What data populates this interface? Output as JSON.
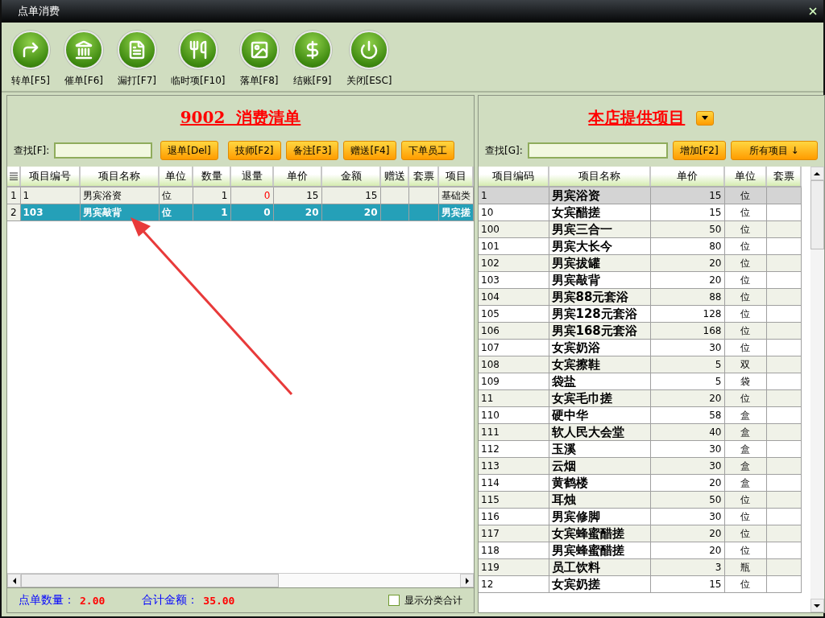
{
  "window": {
    "title": "点单消费"
  },
  "toolbar": [
    {
      "label": "转单[F5]"
    },
    {
      "label": "催单[F6]"
    },
    {
      "label": "漏打[F7]"
    },
    {
      "label": "临时项[F10]"
    },
    {
      "label": "落单[F8]"
    },
    {
      "label": "结账[F9]"
    },
    {
      "label": "关闭[ESC]"
    }
  ],
  "order_panel": {
    "title": "9002  消费清单",
    "search": {
      "label": "查找[F]:"
    },
    "buttons": [
      "退单[Del]",
      "技师[F2]",
      "备注[F3]",
      "赠送[F4]",
      "下单员工"
    ],
    "columns": [
      {
        "label": "项目编号"
      },
      {
        "label": "项目名称"
      },
      {
        "label": "单位"
      },
      {
        "label": "数量"
      },
      {
        "label": "退量",
        "kind": "return"
      },
      {
        "label": "单价"
      },
      {
        "label": "金额"
      },
      {
        "label": "赠送"
      },
      {
        "label": "套票"
      },
      {
        "label": "项目"
      }
    ],
    "rows": [
      {
        "number": "1",
        "selected": false,
        "cells": [
          "1",
          "男宾浴资",
          "位",
          "1",
          "0",
          "15",
          "15",
          "",
          "",
          "基础类"
        ]
      },
      {
        "number": "2",
        "selected": true,
        "cells": [
          "103",
          "男宾敲背",
          "位",
          "1",
          "0",
          "20",
          "20",
          "",
          "",
          "男宾搓"
        ]
      }
    ],
    "footer": {
      "count_label": "点单数量：",
      "count": "2.00",
      "total_label": "合计金额：",
      "total": "35.00",
      "category_toggle": {
        "label": "显示分类合计",
        "checked": false
      }
    }
  },
  "items_panel": {
    "title": "本店提供项目",
    "search": {
      "label": "查找[G]:"
    },
    "buttons": [
      "增加[F2]",
      "所有项目 ↓"
    ],
    "columns": [
      {
        "label": "项目编码"
      },
      {
        "label": "项目名称"
      },
      {
        "label": "单价"
      },
      {
        "label": "单位"
      },
      {
        "label": "套票"
      }
    ],
    "rows": [
      {
        "selected": true,
        "cells": [
          "1",
          "男宾浴资",
          "15",
          "位",
          ""
        ]
      },
      {
        "selected": false,
        "cells": [
          "10",
          "女宾醋搓",
          "15",
          "位",
          ""
        ]
      },
      {
        "selected": false,
        "cells": [
          "100",
          "男宾三合一",
          "50",
          "位",
          ""
        ]
      },
      {
        "selected": false,
        "cells": [
          "101",
          "男宾大长今",
          "80",
          "位",
          ""
        ]
      },
      {
        "selected": false,
        "cells": [
          "102",
          "男宾拔罐",
          "20",
          "位",
          ""
        ]
      },
      {
        "selected": false,
        "cells": [
          "103",
          "男宾敲背",
          "20",
          "位",
          ""
        ]
      },
      {
        "selected": false,
        "cells": [
          "104",
          "男宾88元套浴",
          "88",
          "位",
          ""
        ]
      },
      {
        "selected": false,
        "cells": [
          "105",
          "男宾128元套浴",
          "128",
          "位",
          ""
        ]
      },
      {
        "selected": false,
        "cells": [
          "106",
          "男宾168元套浴",
          "168",
          "位",
          ""
        ]
      },
      {
        "selected": false,
        "cells": [
          "107",
          "女宾奶浴",
          "30",
          "位",
          ""
        ]
      },
      {
        "selected": false,
        "cells": [
          "108",
          "女宾擦鞋",
          "5",
          "双",
          ""
        ]
      },
      {
        "selected": false,
        "cells": [
          "109",
          "袋盐",
          "5",
          "袋",
          ""
        ]
      },
      {
        "selected": false,
        "cells": [
          "11",
          "女宾毛巾搓",
          "20",
          "位",
          ""
        ]
      },
      {
        "selected": false,
        "cells": [
          "110",
          "硬中华",
          "58",
          "盒",
          ""
        ]
      },
      {
        "selected": false,
        "cells": [
          "111",
          "软人民大会堂",
          "40",
          "盒",
          ""
        ]
      },
      {
        "selected": false,
        "cells": [
          "112",
          "玉溪",
          "30",
          "盒",
          ""
        ]
      },
      {
        "selected": false,
        "cells": [
          "113",
          "云烟",
          "30",
          "盒",
          ""
        ]
      },
      {
        "selected": false,
        "cells": [
          "114",
          "黄鹤楼",
          "20",
          "盒",
          ""
        ]
      },
      {
        "selected": false,
        "cells": [
          "115",
          "耳烛",
          "50",
          "位",
          ""
        ]
      },
      {
        "selected": false,
        "cells": [
          "116",
          "男宾修脚",
          "30",
          "位",
          ""
        ]
      },
      {
        "selected": false,
        "cells": [
          "117",
          "女宾蜂蜜醋搓",
          "20",
          "位",
          ""
        ]
      },
      {
        "selected": false,
        "cells": [
          "118",
          "男宾蜂蜜醋搓",
          "20",
          "位",
          ""
        ]
      },
      {
        "selected": false,
        "cells": [
          "119",
          "员工饮料",
          "3",
          "瓶",
          ""
        ]
      },
      {
        "selected": false,
        "cells": [
          "12",
          "女宾奶搓",
          "15",
          "位",
          ""
        ]
      }
    ]
  }
}
